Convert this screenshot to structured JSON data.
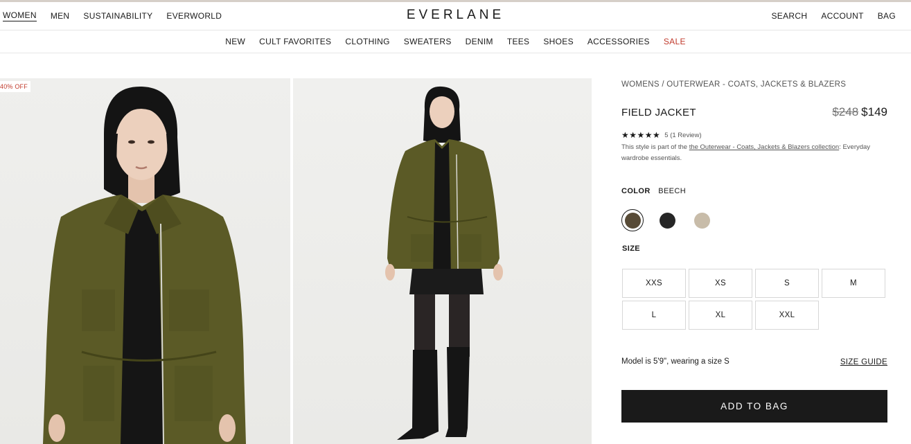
{
  "header": {
    "left_nav": [
      "WOMEN",
      "MEN",
      "SUSTAINABILITY",
      "EVERWORLD"
    ],
    "logo": "EVERLANE",
    "right_nav": [
      "SEARCH",
      "ACCOUNT",
      "BAG"
    ]
  },
  "category_nav": [
    "NEW",
    "CULT FAVORITES",
    "CLOTHING",
    "SWEATERS",
    "DENIM",
    "TEES",
    "SHOES",
    "ACCESSORIES",
    "SALE"
  ],
  "gallery": {
    "badge": "40% OFF",
    "jacket_color": "#5b5a26"
  },
  "product": {
    "breadcrumb": "WOMENS / OUTERWEAR - COATS, JACKETS & BLAZERS",
    "name": "FIELD JACKET",
    "price_original": "$248",
    "price_sale": "$149",
    "stars": "★★★★★",
    "rating": "5 (1 Review)",
    "description_prefix": "This style is part of the ",
    "collection_link": "the Outerwear - Coats, Jackets & Blazers collection",
    "description_suffix": ": Everyday wardrobe essentials.",
    "color_label": "COLOR",
    "color_value": "BEECH",
    "swatches": [
      {
        "name": "Beech",
        "hex": "#574a36"
      },
      {
        "name": "Black",
        "hex": "#262626"
      },
      {
        "name": "Stone",
        "hex": "#c8bca9"
      }
    ],
    "size_label": "SIZE",
    "sizes": [
      "XXS",
      "XS",
      "S",
      "M",
      "L",
      "XL",
      "XXL"
    ],
    "model_text": "Model is 5'9\", wearing a size S",
    "size_guide": "SIZE GUIDE",
    "add_to_bag": "ADD TO BAG"
  }
}
